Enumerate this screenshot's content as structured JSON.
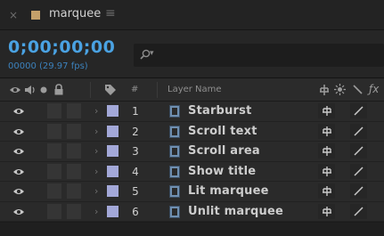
{
  "tab": {
    "title": "marquee",
    "swatch_color": "#c4a06a"
  },
  "header": {
    "timecode": "0;00;00;00",
    "frame_info": "00000 (29.97 fps)",
    "search_placeholder": ""
  },
  "columns": {
    "number": "#",
    "layer_name": "Layer Name"
  },
  "layers": [
    {
      "num": "1",
      "name": "Starburst",
      "label_color": "#a3a8d8"
    },
    {
      "num": "2",
      "name": "Scroll text",
      "label_color": "#a3a8d8"
    },
    {
      "num": "3",
      "name": "Scroll area",
      "label_color": "#a3a8d8"
    },
    {
      "num": "4",
      "name": "Show title",
      "label_color": "#a3a8d8"
    },
    {
      "num": "5",
      "name": "Lit marquee",
      "label_color": "#a3a8d8"
    },
    {
      "num": "6",
      "name": "Unlit marquee",
      "label_color": "#a3a8d8"
    }
  ],
  "colors": {
    "accent": "#4aa2e2",
    "frame_info": "#3c82bd"
  }
}
